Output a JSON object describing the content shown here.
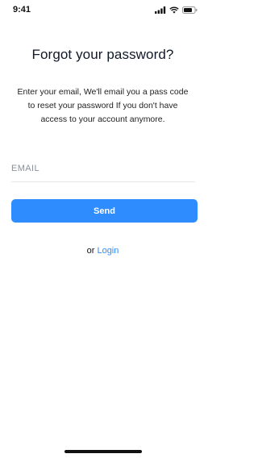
{
  "status_bar": {
    "time": "9:41",
    "icons": [
      "signal-icon",
      "wifi-icon",
      "battery-icon"
    ]
  },
  "screen": {
    "title": "Forgot your password?",
    "description": "Enter your email, We'll email you a pass code to reset your password If you don't have access to your account anymore."
  },
  "form": {
    "email_placeholder": "EMAIL",
    "email_value": "",
    "send_label": "Send"
  },
  "footer": {
    "or_text": "or",
    "login_label": "Login"
  },
  "colors": {
    "accent": "#2f8cff",
    "text": "#111827",
    "placeholder": "#8a8f9c",
    "divider": "#e6e6ea"
  }
}
